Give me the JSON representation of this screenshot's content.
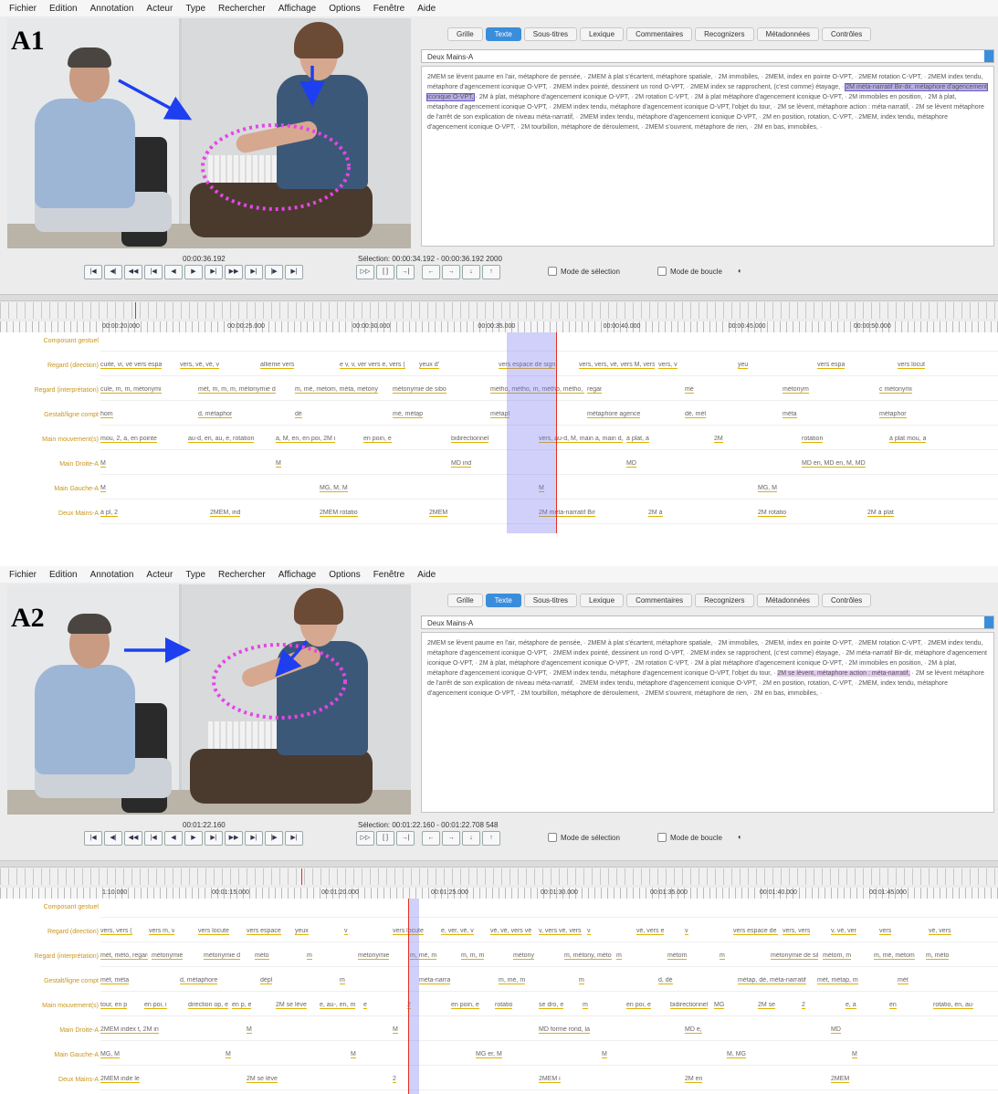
{
  "panels": [
    {
      "label": "A1",
      "menu": [
        "Fichier",
        "Edition",
        "Annotation",
        "Acteur",
        "Type",
        "Rechercher",
        "Affichage",
        "Options",
        "Fenêtre",
        "Aide"
      ],
      "tabs": [
        "Grille",
        "Texte",
        "Sous-titres",
        "Lexique",
        "Commentaires",
        "Recognizers",
        "Métadonnées",
        "Contrôles"
      ],
      "active_tab": "Texte",
      "tier_name": "Deux Mains-A",
      "text_before": "2MEM se lèvent paume en l'air, métaphore de pensée, · 2MEM à plat s'écartent, métaphore spatiale, · 2M immobiles, · 2MEM, index en pointe O-VPT, · 2MEM rotation C-VPT, · 2MEM index tendu, métaphore d'agencement iconique O-VPT, · 2MEM index pointé, dessinent un rond O-VPT, · 2MEM index se rapprochent, (c'est comme) étayage, · ",
      "text_highlight": "2M méta-narratif Bir-dir, métaphore d'agencement iconique O-VPT,",
      "text_after": " · 2M à plat, métaphore d'agencement iconique O-VPT, · 2M rotation C-VPT, · 2M à plat métaphore d'agencement iconique O-VPT, · 2M immobiles en position, · 2M à plat, métaphore d'agencement iconique O-VPT, · 2MEM index tendu, métaphore d'agencement iconique O-VPT, l'objet du tour, · 2M se lèvent, métaphore action : méta-narratif, · 2M se lèvent métaphore de l'arrêt de son explication de niveau méta-narratif, · 2MEM index tendu, métaphore d'agencement iconique O-VPT, · 2M en position, rotation, C-VPT, · 2MEM, index tendu, métaphore d'agencement iconique O-VPT, · 2M tourbillon, métaphore de déroulement, · 2MEM s'ouvrent, métaphore de rien, · 2M en bas, immobiles, ·",
      "timecode": "00:00:36.192",
      "selection": "Sélection: 00:00:34.192 - 00:00:36.192  2000",
      "mode_selection": "Mode de sélection",
      "mode_boucle": "Mode de boucle",
      "ruler_ticks": [
        "00:00:20.000",
        "00:00:25.000",
        "00:00:30.000",
        "00:00:35.000",
        "00:00:40.000",
        "00:00:45.000",
        "00:00:50.000"
      ],
      "tiers": [
        {
          "name": "Composant gestuel",
          "anns": []
        },
        {
          "name": "Regard (direction)",
          "anns": [
            "cuite, vi, vé vers espa",
            "vers, vé, vé, v",
            "allieme vers",
            "e v, v, ver vers e, vers (",
            "yeux d'",
            "vers espace de sign",
            "vers, vers, vé, vers M, vers M, vé, vers",
            "vers, v",
            "yeu",
            "vers espa",
            "vers locut"
          ]
        },
        {
          "name": "Regard (interprétation)",
          "anns": [
            "cule, m, m, métonymi",
            "mét, m, m, m, métonymie d",
            "m, mé, métom, méta, métony",
            "métonymie de sibo",
            "métho, métho, m, métho, métho, m",
            "regar",
            "mé",
            "métonym",
            "c métonymi"
          ]
        },
        {
          "name": "Gestalt/ligne compt",
          "anns": [
            "hom",
            "d, métaphor",
            "dé",
            "mé, métap",
            "métapl",
            "métaphore agence",
            "dé, mét",
            "méta",
            "métaphor"
          ]
        },
        {
          "name": "Main mouvement(s)",
          "anns": [
            "mou, 2, a, en pointe",
            "au-d, en, au, e, rotation",
            "a, M, en, en poi, 2M i",
            "en poin, e",
            "bidirectionnel",
            "vers, au-d, M, main a, main d, en, à pl",
            "à plat, a",
            "2M",
            "rotation",
            "à plat mou, a"
          ]
        },
        {
          "name": "Main Droite-A",
          "anns": [
            "M",
            "M",
            "MD ind",
            "MD",
            "MD en, MD en, M, MD"
          ]
        },
        {
          "name": "Main Gauche-A",
          "anns": [
            "M",
            "MG, M, M",
            "M",
            "MG, M"
          ]
        },
        {
          "name": "Deux Mains-A",
          "anns": [
            "à pl, 2",
            "2MEM, ind",
            "2MEM rotatio",
            "2MEM",
            "2M méta-narratif Bir",
            "2M à",
            "2M rotatio",
            "2M à plat"
          ]
        }
      ]
    },
    {
      "label": "A2",
      "menu": [
        "Fichier",
        "Edition",
        "Annotation",
        "Acteur",
        "Type",
        "Rechercher",
        "Affichage",
        "Options",
        "Fenêtre",
        "Aide"
      ],
      "tabs": [
        "Grille",
        "Texte",
        "Sous-titres",
        "Lexique",
        "Commentaires",
        "Recognizers",
        "Métadonnées",
        "Contrôles"
      ],
      "active_tab": "Texte",
      "tier_name": "Deux Mains-A",
      "text_before": "2MEM se lèvent paume en l'air, métaphore de pensée, · 2MEM à plat s'écartent, métaphore spatiale, · 2M immobiles, · 2MEM, index en pointe O-VPT, · 2MEM rotation C-VPT, · 2MEM index tendu, métaphore d'agencement iconique O-VPT, · 2MEM index pointé, dessinent un rond O-VPT, · 2MEM index se rapprochent, (c'est comme) étayage, · 2M méta-narratif Bir-dir, métaphore d'agencement iconique O-VPT, · 2M à plat, métaphore d'agencement iconique O-VPT, · 2M rotation C-VPT, · 2M à plat métaphore d'agencement iconique O-VPT, · 2M immobiles en position, · 2M à plat, métaphore d'agencement iconique O-VPT, · 2MEM index tendu, métaphore d'agencement iconique O-VPT, l'objet du tour, · ",
      "text_highlight": "2M se lèvent, métaphore action : méta-narratif,",
      "text_after": " · 2M se lèvent métaphore de l'arrêt de son explication de niveau méta-narratif, · 2MEM index tendu, métaphore d'agencement iconique O-VPT, · 2M en position, rotation, C-VPT, · 2MEM, index tendu, métaphore d'agencement iconique O-VPT, · 2M tourbillon, métaphore de déroulement, · 2MEM s'ouvrent, métaphore de rien, · 2M en bas, immobiles, ·",
      "timecode": "00:01:22.160",
      "selection": "Sélection: 00:01:22.160 - 00:01:22.708  548",
      "mode_selection": "Mode de sélection",
      "mode_boucle": "Mode de boucle",
      "ruler_ticks": [
        "1:10.000",
        "00:01:15.000",
        "00:01:20.000",
        "00:01:25.000",
        "00:01:30.000",
        "00:01:35.000",
        "00:01:40.000",
        "00:01:45.000"
      ],
      "tiers": [
        {
          "name": "Composant gestuel",
          "anns": []
        },
        {
          "name": "Regard (direction)",
          "anns": [
            "vers, vers (",
            "vers m, v",
            "vers locute",
            "vers espace",
            "yeux",
            "v",
            "vers locute",
            "e, ver, vé, v",
            "vé, vé, vers vé",
            "v, vers vé, vers",
            "v",
            "vé, vers e",
            "v",
            "vers espace de si",
            "vers, vers",
            "v, vé, ver",
            "vers",
            "vé, vers"
          ]
        },
        {
          "name": "Regard (interprétation)",
          "anns": [
            "mét, métó, regard",
            "métonymie",
            "métonymie d",
            "méto",
            "m",
            "métonymie",
            "m, mé, m",
            "m, m, m",
            "métony",
            "m, métony, métom, m",
            "m",
            "métom",
            "m",
            "métonymie de sib",
            "métom, m",
            "m, mé, métom",
            "m, méto"
          ]
        },
        {
          "name": "Gestalt/ligne compt",
          "anns": [
            "mét, méta",
            "d, métaphore",
            "dépl",
            "m",
            "méta-narra",
            "m, mé, m",
            "m",
            "d, dé",
            "métap, dé, méta-narratif",
            "mét, métap, m",
            "mét"
          ]
        },
        {
          "name": "Main mouvement(s)",
          "anns": [
            "tour, en p",
            "en poi, i",
            "direction op, en pointe",
            "en p, e",
            "2M se lève",
            "e, au-, en, m",
            "e",
            "2",
            "en poin, e",
            "rotatio",
            "se dro, e",
            "m",
            "en poi, e",
            "bidirectionnel",
            "MG",
            "2M se",
            "2",
            "e, a",
            "en",
            "rotatio, en, au-"
          ]
        },
        {
          "name": "Main Droite-A",
          "anns": [
            "2MEM index t, 2M in",
            "M",
            "M",
            "MD forme rond, la",
            "MD e,",
            "MD"
          ]
        },
        {
          "name": "Main Gauche-A",
          "anns": [
            "MG, M",
            "M",
            "M",
            "MG er, M",
            "M",
            "M, MG",
            "M"
          ]
        },
        {
          "name": "Deux Mains-A",
          "anns": [
            "2MEM inde le",
            "2M se lève",
            "2",
            "2MEM i",
            "2M en",
            "2MEM"
          ]
        }
      ]
    }
  ]
}
